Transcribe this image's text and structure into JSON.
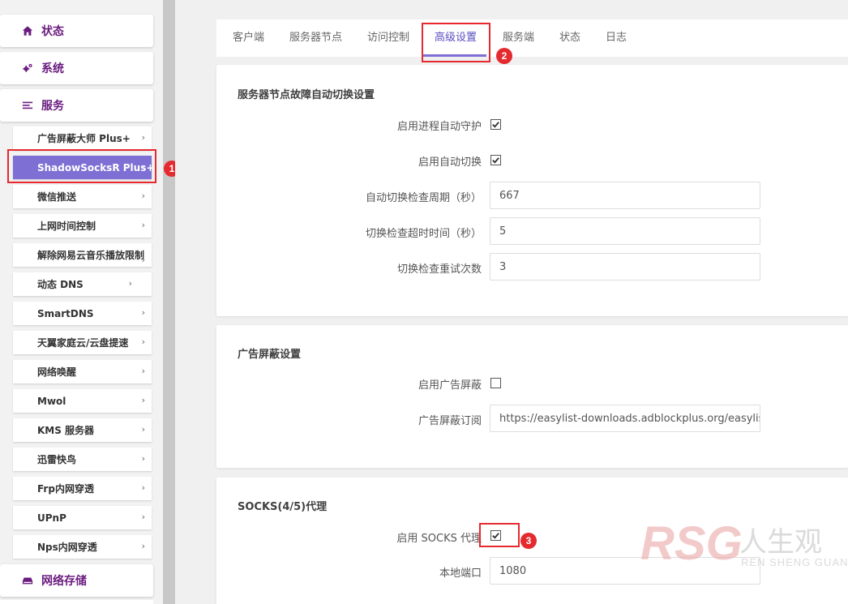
{
  "sidebar": {
    "status_label": "状态",
    "system_label": "系统",
    "services_label": "服务",
    "network_storage_label": "网络存储",
    "services_items": [
      {
        "label": "广告屏蔽大师 Plus+"
      },
      {
        "label": "ShadowSocksR Plus+"
      },
      {
        "label": "微信推送"
      },
      {
        "label": "上网时间控制"
      },
      {
        "label": "解除网易云音乐播放限制"
      },
      {
        "label": "动态 DNS"
      },
      {
        "label": "SmartDNS"
      },
      {
        "label": "天翼家庭云/云盘提速"
      },
      {
        "label": "网络唤醒"
      },
      {
        "label": "Mwol"
      },
      {
        "label": "KMS 服务器"
      },
      {
        "label": "迅雷快鸟"
      },
      {
        "label": "Frp内网穿透"
      },
      {
        "label": "UPnP"
      },
      {
        "label": "Nps内网穿透"
      }
    ],
    "chevron": "›"
  },
  "tabs": [
    {
      "label": "客户端"
    },
    {
      "label": "服务器节点"
    },
    {
      "label": "访问控制"
    },
    {
      "label": "高级设置"
    },
    {
      "label": "服务端"
    },
    {
      "label": "状态"
    },
    {
      "label": "日志"
    }
  ],
  "failover": {
    "title": "服务器节点故障自动切换设置",
    "enable_daemon_label": "启用进程自动守护",
    "enable_daemon_checked": true,
    "enable_switch_label": "启用自动切换",
    "enable_switch_checked": true,
    "check_period_label": "自动切换检查周期（秒）",
    "check_period_value": "667",
    "timeout_label": "切换检查超时时间（秒）",
    "timeout_value": "5",
    "retry_label": "切换检查重试次数",
    "retry_value": "3"
  },
  "adblock": {
    "title": "广告屏蔽设置",
    "enable_label": "启用广告屏蔽",
    "enable_checked": false,
    "subscription_label": "广告屏蔽订阅",
    "subscription_value": "https://easylist-downloads.adblockplus.org/easylistchina+easylist.txt"
  },
  "socks": {
    "title": "SOCKS(4/5)代理",
    "enable_label": "启用 SOCKS 代理",
    "enable_checked": true,
    "port_label": "本地端口",
    "port_value": "1080"
  },
  "annotations": [
    "1",
    "2",
    "3"
  ],
  "watermark": {
    "logo": "RSG",
    "cn": "人生观",
    "en": "REN SHENG GUAN"
  },
  "colors": {
    "brand_purple": "#6a1b7f",
    "accent": "#7d6fd4",
    "annotation_red": "#e5292f"
  }
}
